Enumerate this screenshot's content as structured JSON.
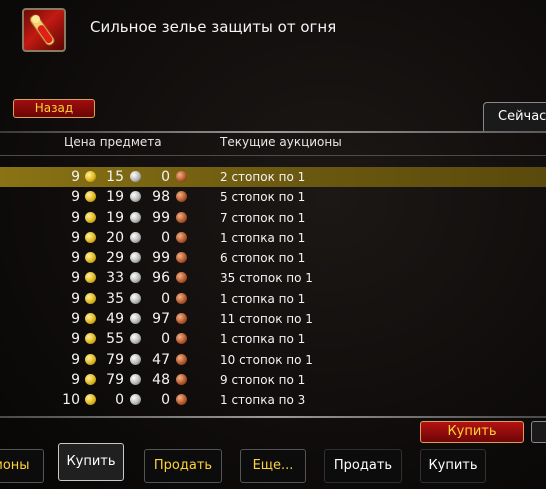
{
  "item": {
    "title": "Сильное зелье защиты от огня",
    "icon": "potion-icon"
  },
  "back_label": "Назад",
  "tab_now": "Сейчас",
  "columns": {
    "price": "Цена предмета",
    "auctions": "Текущие аукционы"
  },
  "rows": [
    {
      "gold": "9",
      "silver": "15",
      "copper": "0",
      "stacks": "2 стопок по 1",
      "selected": true
    },
    {
      "gold": "9",
      "silver": "19",
      "copper": "98",
      "stacks": "5 стопок по 1"
    },
    {
      "gold": "9",
      "silver": "19",
      "copper": "99",
      "stacks": "7 стопок по 1"
    },
    {
      "gold": "9",
      "silver": "20",
      "copper": "0",
      "stacks": "1 стопка по 1"
    },
    {
      "gold": "9",
      "silver": "29",
      "copper": "99",
      "stacks": "6 стопок по 1"
    },
    {
      "gold": "9",
      "silver": "33",
      "copper": "96",
      "stacks": "35 стопок по 1"
    },
    {
      "gold": "9",
      "silver": "35",
      "copper": "0",
      "stacks": "1 стопка по 1"
    },
    {
      "gold": "9",
      "silver": "49",
      "copper": "97",
      "stacks": "11 стопок по 1"
    },
    {
      "gold": "9",
      "silver": "55",
      "copper": "0",
      "stacks": "1 стопка по 1"
    },
    {
      "gold": "9",
      "silver": "79",
      "copper": "47",
      "stacks": "10 стопок по 1"
    },
    {
      "gold": "9",
      "silver": "79",
      "copper": "48",
      "stacks": "9 стопок по 1"
    },
    {
      "gold": "10",
      "silver": "0",
      "copper": "0",
      "stacks": "1 стопка по 3"
    }
  ],
  "buy_button": "Купить",
  "bottom_tabs": [
    "ионы",
    "Купить",
    "Продать",
    "Еще...",
    "Продать",
    "Купить"
  ],
  "colors": {
    "accent_gold": "#ffd23a",
    "selected_row": "#8a7314",
    "button_red": "#b51212"
  }
}
